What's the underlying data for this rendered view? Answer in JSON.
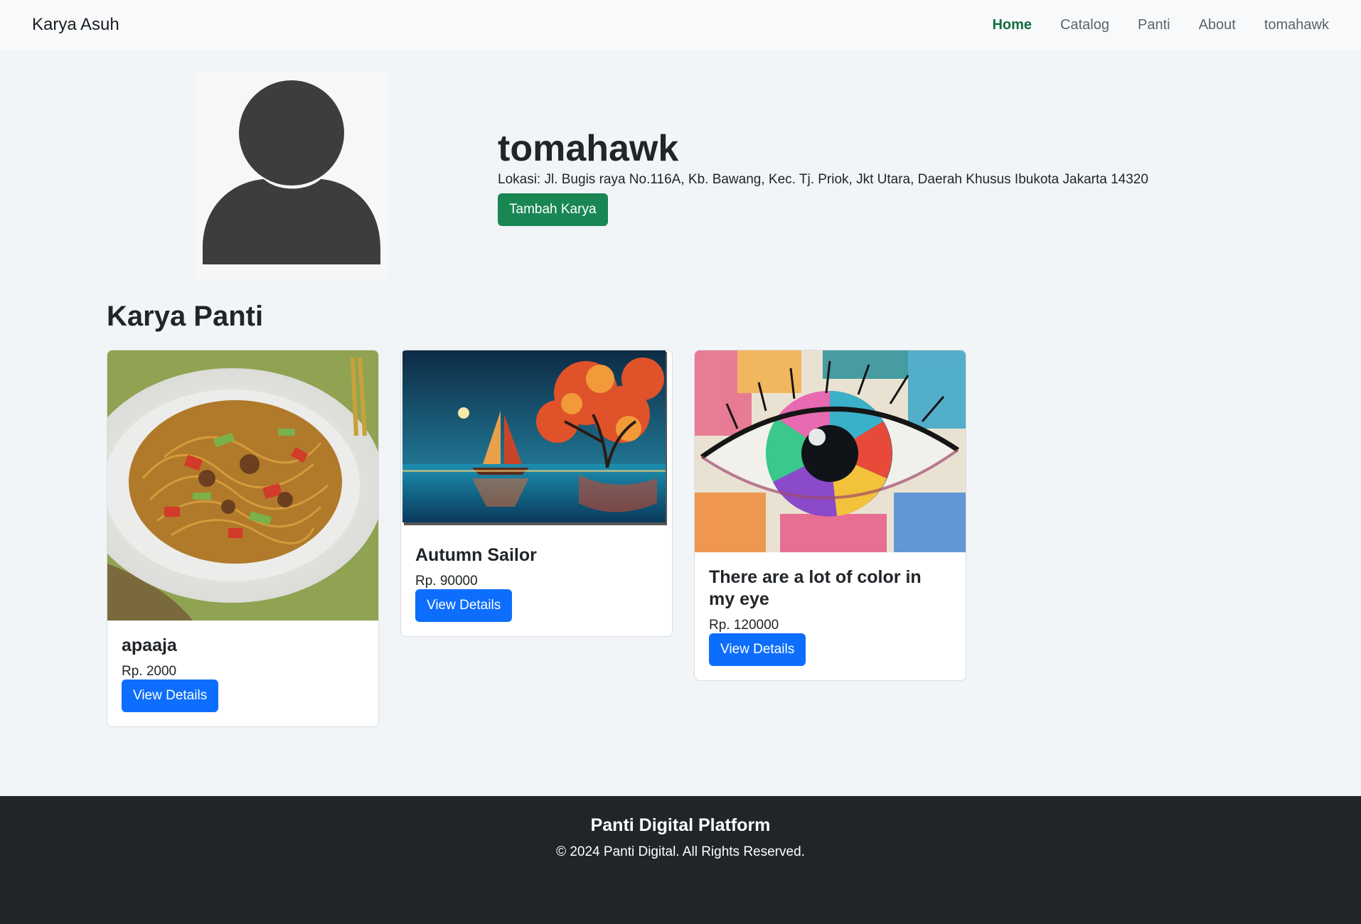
{
  "navbar": {
    "brand": "Karya Asuh",
    "links": [
      {
        "label": "Home",
        "active": true
      },
      {
        "label": "Catalog",
        "active": false
      },
      {
        "label": "Panti",
        "active": false
      },
      {
        "label": "About",
        "active": false
      },
      {
        "label": "tomahawk",
        "active": false
      }
    ]
  },
  "profile": {
    "name": "tomahawk",
    "location": "Lokasi: Jl. Bugis raya No.116A, Kb. Bawang, Kec. Tj. Priok, Jkt Utara, Daerah Khusus Ibukota Jakarta 14320",
    "add_button": "Tambah Karya",
    "avatar_icon": "user-silhouette-icon"
  },
  "section": {
    "title": "Karya Panti"
  },
  "cards": [
    {
      "title": "apaaja",
      "price": "Rp. 2000",
      "button": "View Details",
      "image": "noodle-dish-photo"
    },
    {
      "title": "Autumn Sailor",
      "price": "Rp. 90000",
      "button": "View Details",
      "image": "sailboat-painting"
    },
    {
      "title": "There are a lot of color in my eye",
      "price": "Rp. 120000",
      "button": "View Details",
      "image": "colorful-eye-painting"
    }
  ],
  "footer": {
    "title": "Panti Digital Platform",
    "copyright": "© 2024 Panti Digital. All Rights Reserved."
  },
  "colors": {
    "nav_active": "#146c43",
    "primary": "#0d6efd",
    "success": "#198754",
    "footer_bg": "#212529"
  }
}
